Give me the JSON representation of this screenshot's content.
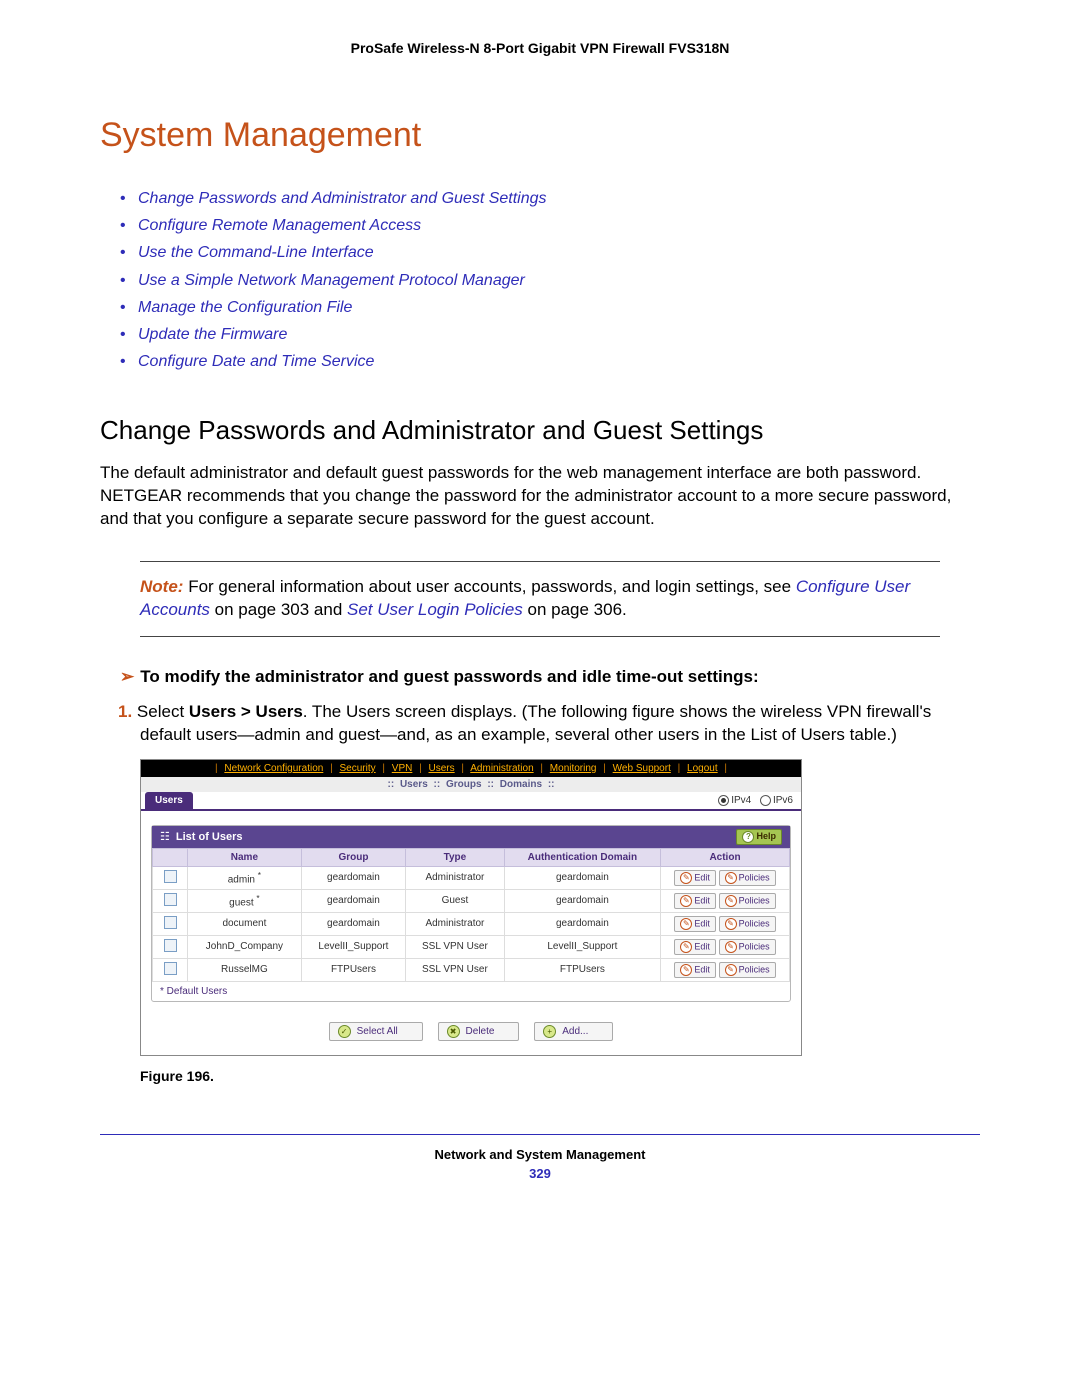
{
  "header": {
    "product": "ProSafe Wireless-N 8-Port Gigabit VPN Firewall FVS318N"
  },
  "title": "System Management",
  "toc": [
    "Change Passwords and Administrator and Guest Settings",
    "Configure Remote Management Access",
    "Use the Command-Line Interface",
    "Use a Simple Network Management Protocol Manager",
    "Manage the Configuration File",
    "Update the Firmware",
    "Configure Date and Time Service"
  ],
  "section": {
    "heading": "Change Passwords and Administrator and Guest Settings",
    "intro": "The default administrator and default guest passwords for the web management interface are both password. NETGEAR recommends that you change the password for the administrator account to a more secure password, and that you configure a separate secure password for the guest account."
  },
  "note": {
    "label": "Note:",
    "text_a": "For general information about user accounts, passwords, and login settings, see ",
    "link_a": "Configure User Accounts",
    "mid_a": " on page 303 and ",
    "link_b": "Set User Login Policies",
    "mid_b": " on page 306."
  },
  "procedure": {
    "lead": "To modify the administrator and guest passwords and idle time-out settings:",
    "step1_num": "1.",
    "step1_a": "Select ",
    "step1_bold": "Users > Users",
    "step1_b": ". The Users screen displays. (The following figure shows the wireless VPN firewall's default users—admin and guest—and, as an example, several other users in the List of Users table.)"
  },
  "ui": {
    "topnav": [
      "Network Configuration",
      "Security",
      "VPN",
      "Users",
      "Administration",
      "Monitoring",
      "Web Support",
      "Logout"
    ],
    "subnav": {
      "items": [
        "Users",
        "Groups",
        "Domains"
      ],
      "sep": "::"
    },
    "tab": "Users",
    "ip4": "IPv4",
    "ip6": "IPv6",
    "panel_title": "List of Users",
    "help": "Help",
    "columns": [
      "",
      "Name",
      "Group",
      "Type",
      "Authentication Domain",
      "Action"
    ],
    "rows": [
      {
        "name": "admin",
        "star": true,
        "group": "geardomain",
        "type": "Administrator",
        "auth": "geardomain"
      },
      {
        "name": "guest",
        "star": true,
        "group": "geardomain",
        "type": "Guest",
        "auth": "geardomain"
      },
      {
        "name": "document",
        "star": false,
        "group": "geardomain",
        "type": "Administrator",
        "auth": "geardomain"
      },
      {
        "name": "JohnD_Company",
        "star": false,
        "group": "LevelII_Support",
        "type": "SSL VPN User",
        "auth": "LevelII_Support"
      },
      {
        "name": "RusselMG",
        "star": false,
        "group": "FTPUsers",
        "type": "SSL VPN User",
        "auth": "FTPUsers"
      }
    ],
    "actions": {
      "edit": "Edit",
      "policies": "Policies"
    },
    "default_note": "* Default Users",
    "buttons": {
      "select_all": "Select All",
      "delete": "Delete",
      "add": "Add..."
    }
  },
  "figure": "Figure 196.",
  "footer": {
    "chapter": "Network and System Management",
    "page": "329"
  }
}
